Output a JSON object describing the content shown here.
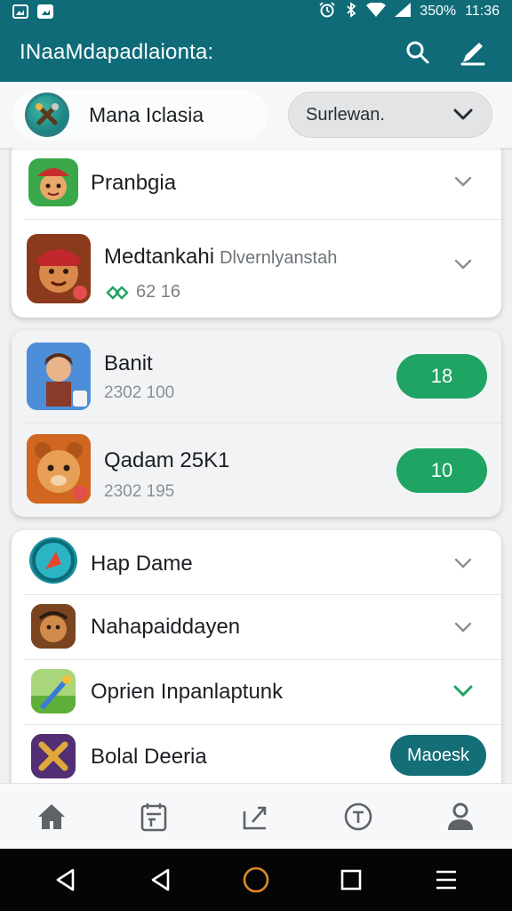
{
  "status_bar": {
    "left_icons": [
      "image-notification-icon",
      "image-notification-icon"
    ],
    "right_icons": [
      "alarm-icon",
      "bluetooth-icon",
      "wifi-icon",
      "signal-icon"
    ],
    "battery": "350%",
    "time": "11:36"
  },
  "app_bar": {
    "title": "INaaMdapadlaionta:",
    "actions": [
      "search-icon",
      "edit-icon"
    ]
  },
  "header": {
    "profile_name": "Mana Iclasia",
    "dropdown_value": "Surlewan."
  },
  "card1": {
    "items": [
      {
        "title": "Pranbgia",
        "chevron_color": "#8a8f94"
      },
      {
        "title": "Medtankahi",
        "description": "Dlvernlyanstah",
        "sub": "62 16",
        "chevron_color": "#8a8f94"
      }
    ]
  },
  "card2": {
    "items": [
      {
        "title": "Banit",
        "sub": "2302 100",
        "count": "18"
      },
      {
        "title": "Qadam 25K1",
        "sub": "2302 195",
        "count": "10"
      }
    ]
  },
  "card3": {
    "items": [
      {
        "title": "Hap Dame",
        "chevron_color": "#8a8f94"
      },
      {
        "title": "Nahapaiddayen",
        "chevron_color": "#8a8f94"
      },
      {
        "title": "Oprien Inpanlaptunk",
        "chevron_color": "#1fa463"
      },
      {
        "title": "Bolal Deeria",
        "action": "Maoesk"
      }
    ]
  },
  "bottom_nav": [
    "home-icon",
    "calendar-icon",
    "share-icon",
    "timer-icon",
    "profile-icon"
  ],
  "system_nav": [
    "back-icon",
    "back-icon",
    "home-circle-icon",
    "recents-icon",
    "menu-icon"
  ],
  "colors": {
    "primary": "#0f6b78",
    "green": "#1fa463",
    "teal_button": "#136e77"
  }
}
